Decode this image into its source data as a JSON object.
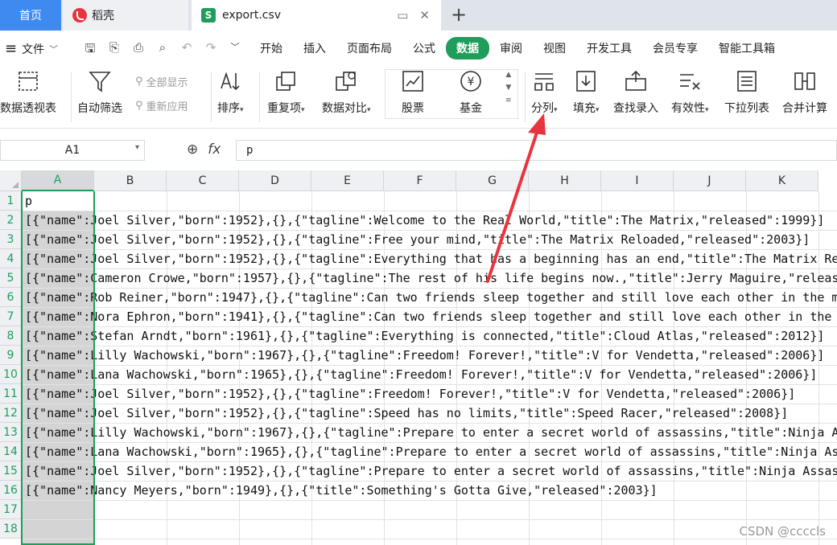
{
  "tabs": {
    "home": "首页",
    "daoke": "稻壳",
    "file": "export.csv",
    "plus": "+"
  },
  "menubar": {
    "file_menu": "文件",
    "items": [
      "开始",
      "插入",
      "页面布局",
      "公式",
      "数据",
      "审阅",
      "视图",
      "开发工具",
      "会员专享",
      "智能工具箱"
    ],
    "active": "数据"
  },
  "ribbon": {
    "pivot": "数据透视表",
    "autofilter": "自动筛选",
    "show_all": "全部显示",
    "reapply": "重新应用",
    "sort": "排序",
    "duplicates": "重复项",
    "compare": "数据对比",
    "stock": "股票",
    "fund": "基金",
    "split": "分列",
    "fill": "填充",
    "lookup": "查找录入",
    "validity": "有效性",
    "dropdown": "下拉列表",
    "merge": "合并计算"
  },
  "formula": {
    "cell_ref": "A1",
    "content": "p"
  },
  "columns": [
    "A",
    "B",
    "C",
    "D",
    "E",
    "F",
    "G",
    "H",
    "I",
    "J",
    "K"
  ],
  "rows": [
    {
      "n": "1",
      "text": "p"
    },
    {
      "n": "2",
      "text": "[{\"name\":Joel Silver,\"born\":1952},{},{\"tagline\":Welcome to the Real World,\"title\":The Matrix,\"released\":1999}]"
    },
    {
      "n": "3",
      "text": "[{\"name\":Joel Silver,\"born\":1952},{},{\"tagline\":Free your mind,\"title\":The Matrix Reloaded,\"released\":2003}]"
    },
    {
      "n": "4",
      "text": "[{\"name\":Joel Silver,\"born\":1952},{},{\"tagline\":Everything that has a beginning has an end,\"title\":The Matrix Re"
    },
    {
      "n": "5",
      "text": "[{\"name\":Cameron Crowe,\"born\":1957},{},{\"tagline\":The rest of his life begins now.,\"title\":Jerry Maguire,\"releas"
    },
    {
      "n": "6",
      "text": "[{\"name\":Rob Reiner,\"born\":1947},{},{\"tagline\":Can two friends sleep together and still love each other in the mo"
    },
    {
      "n": "7",
      "text": "[{\"name\":Nora Ephron,\"born\":1941},{},{\"tagline\":Can two friends sleep together and still love each other in the m"
    },
    {
      "n": "8",
      "text": "[{\"name\":Stefan Arndt,\"born\":1961},{},{\"tagline\":Everything is connected,\"title\":Cloud Atlas,\"released\":2012}]"
    },
    {
      "n": "9",
      "text": "[{\"name\":Lilly Wachowski,\"born\":1967},{},{\"tagline\":Freedom! Forever!,\"title\":V for Vendetta,\"released\":2006}]"
    },
    {
      "n": "10",
      "text": "[{\"name\":Lana Wachowski,\"born\":1965},{},{\"tagline\":Freedom! Forever!,\"title\":V for Vendetta,\"released\":2006}]"
    },
    {
      "n": "11",
      "text": "[{\"name\":Joel Silver,\"born\":1952},{},{\"tagline\":Freedom! Forever!,\"title\":V for Vendetta,\"released\":2006}]"
    },
    {
      "n": "12",
      "text": "[{\"name\":Joel Silver,\"born\":1952},{},{\"tagline\":Speed has no limits,\"title\":Speed Racer,\"released\":2008}]"
    },
    {
      "n": "13",
      "text": "[{\"name\":Lilly Wachowski,\"born\":1967},{},{\"tagline\":Prepare to enter a secret world of assassins,\"title\":Ninja As"
    },
    {
      "n": "14",
      "text": "[{\"name\":Lana Wachowski,\"born\":1965},{},{\"tagline\":Prepare to enter a secret world of assassins,\"title\":Ninja As"
    },
    {
      "n": "15",
      "text": "[{\"name\":Joel Silver,\"born\":1952},{},{\"tagline\":Prepare to enter a secret world of assassins,\"title\":Ninja Assas"
    },
    {
      "n": "16",
      "text": "[{\"name\":Nancy Meyers,\"born\":1949},{},{\"title\":Something's Gotta Give,\"released\":2003}]"
    },
    {
      "n": "17",
      "text": ""
    },
    {
      "n": "18",
      "text": ""
    }
  ],
  "watermark": "CSDN @ccccls",
  "colors": {
    "accent": "#1f9d5b",
    "home_tab": "#3f8af0",
    "arrow": "#e8343f"
  }
}
